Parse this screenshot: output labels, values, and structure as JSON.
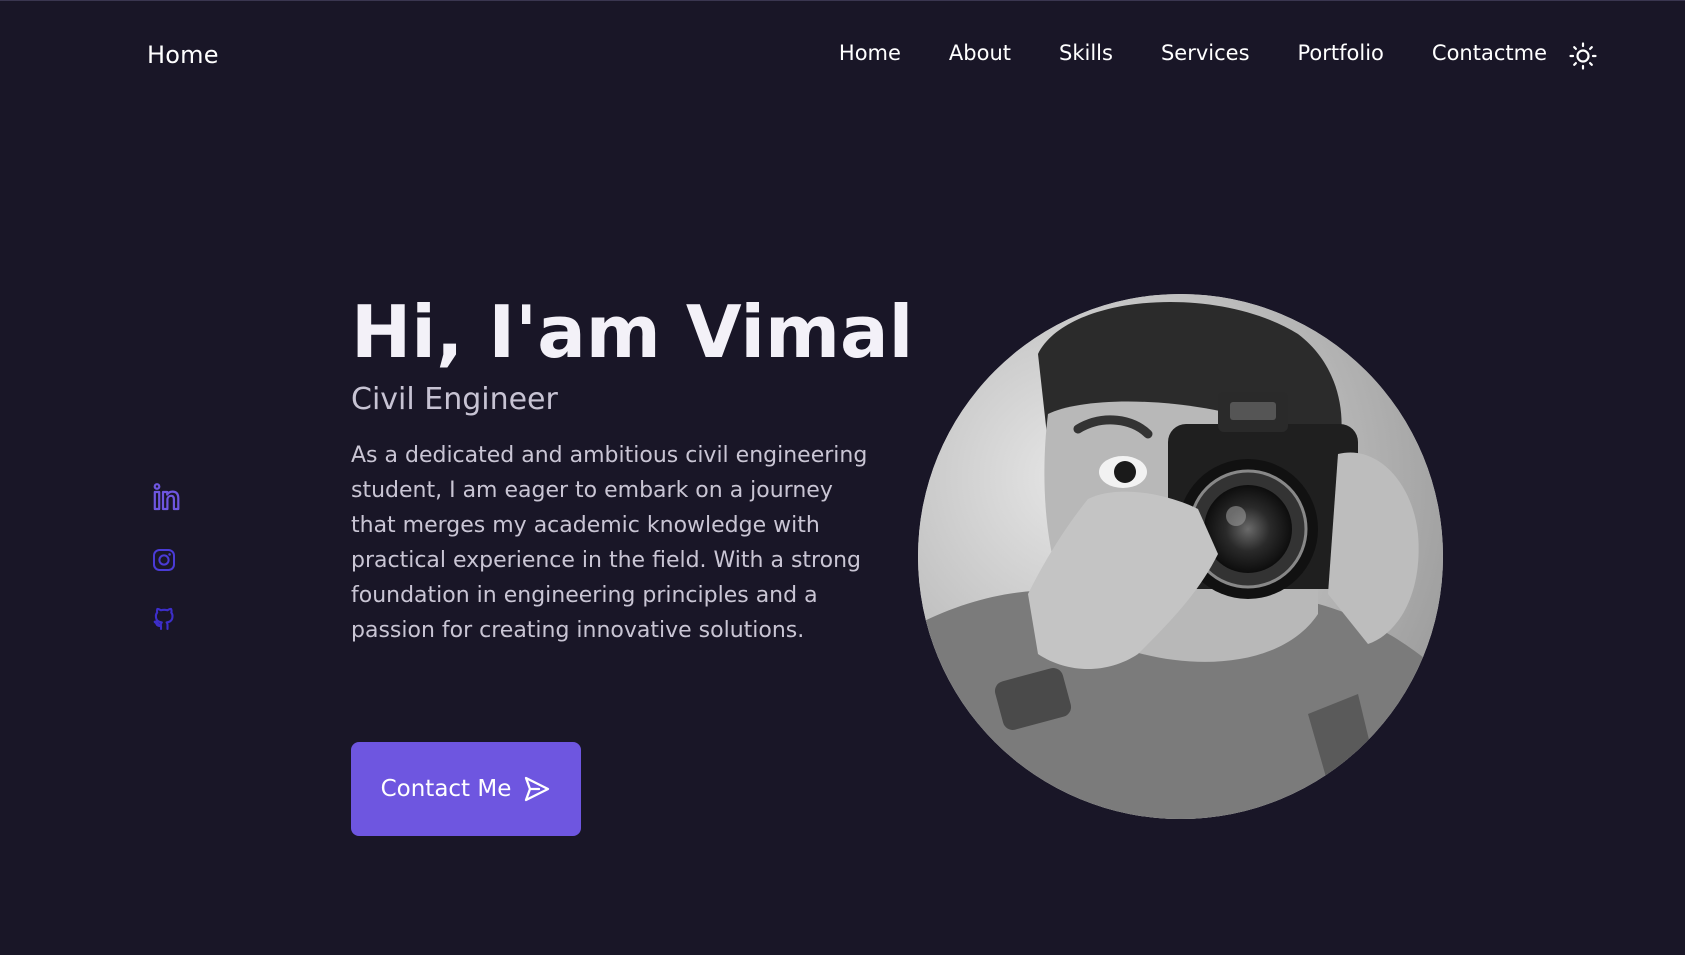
{
  "header": {
    "logo": "Home",
    "nav": [
      "Home",
      "About",
      "Skills",
      "Services",
      "Portfolio",
      "Contactme"
    ],
    "theme_icon": "sun-icon"
  },
  "social": [
    {
      "name": "linkedin-icon",
      "color": "#6e56e0"
    },
    {
      "name": "instagram-icon",
      "color": "#4a3bd6"
    },
    {
      "name": "github-icon",
      "color": "#3d2ec9"
    }
  ],
  "hero": {
    "title": "Hi, I'am Vimal",
    "subtitle": "Civil Engineer",
    "description": "As a dedicated and ambitious civil engineering student, I am eager to embark on a journey that merges my academic knowledge with practical experience in the field. With a strong foundation in engineering principles and a passion for creating innovative solutions.",
    "button_label": "Contact Me",
    "button_icon": "send-icon"
  },
  "colors": {
    "background": "#191627",
    "accent": "#6e56e0",
    "text": "#f1eef8",
    "muted_text": "#c9c5d4"
  }
}
